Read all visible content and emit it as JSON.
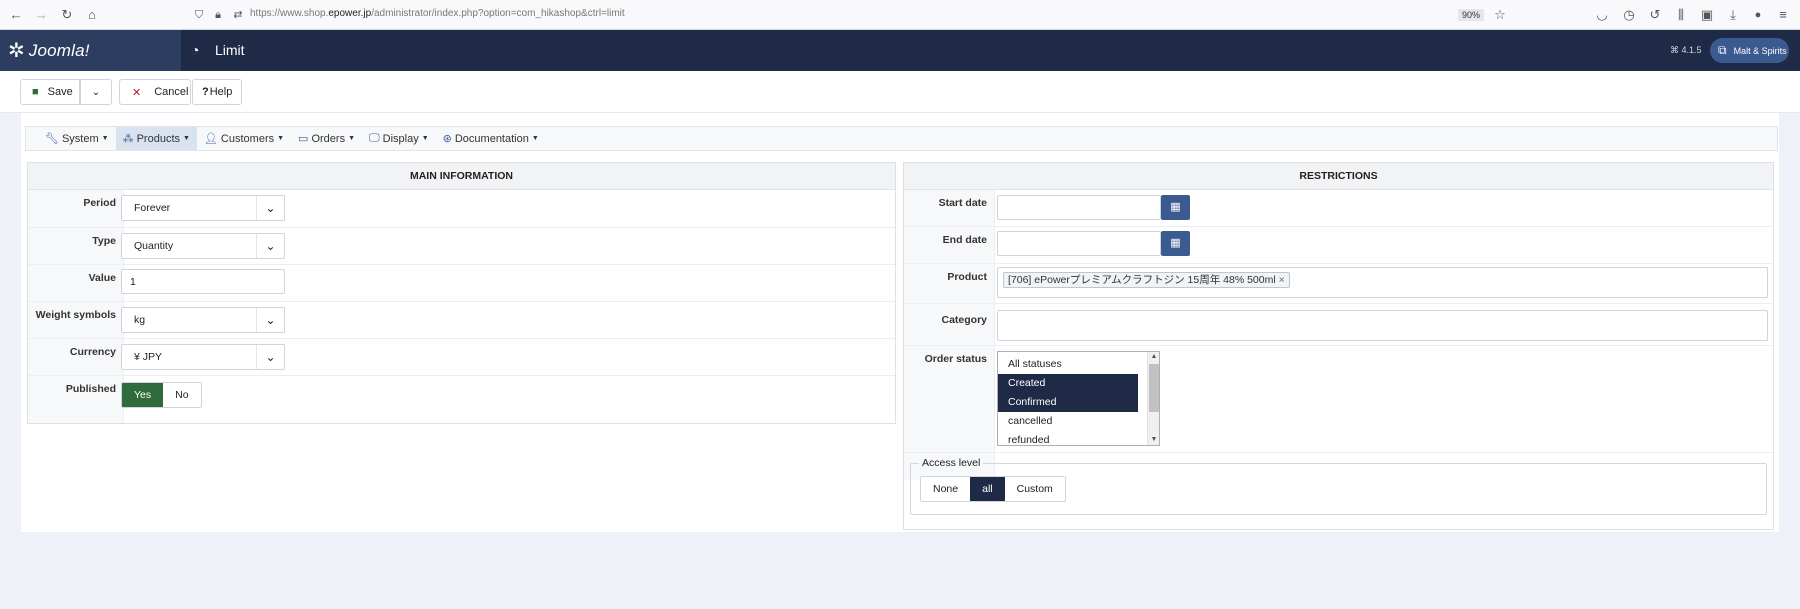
{
  "browser": {
    "url_prefix": "https://www.shop.",
    "url_domain": "epower.jp",
    "url_path": "/administrator/index.php?option=com_hikashop&ctrl=limit",
    "zoom": "90%"
  },
  "header": {
    "logo": "Joomla!",
    "title": "Limit",
    "version": "⌘ 4.1.5",
    "site_button": "Malt & Spirits"
  },
  "toolbar": {
    "save_label": "Save",
    "cancel_label": "Cancel",
    "help_label": "Help"
  },
  "menu": {
    "items": [
      {
        "label": "System",
        "icon": "wrench-icon"
      },
      {
        "label": "Products",
        "icon": "cubes-icon",
        "active": true
      },
      {
        "label": "Customers",
        "icon": "user-icon"
      },
      {
        "label": "Orders",
        "icon": "credit-card-icon"
      },
      {
        "label": "Display",
        "icon": "monitor-icon"
      },
      {
        "label": "Documentation",
        "icon": "lifebuoy-icon"
      }
    ]
  },
  "main_info": {
    "heading": "MAIN INFORMATION",
    "period_label": "Period",
    "period_value": "Forever",
    "type_label": "Type",
    "type_value": "Quantity",
    "value_label": "Value",
    "value_value": "1",
    "weight_label": "Weight symbols",
    "weight_value": "kg",
    "currency_label": "Currency",
    "currency_value": "¥ JPY",
    "published_label": "Published",
    "published_yes": "Yes",
    "published_no": "No",
    "published_selected": "Yes"
  },
  "restrictions": {
    "heading": "RESTRICTIONS",
    "start_date_label": "Start date",
    "start_date_value": "",
    "end_date_label": "End date",
    "end_date_value": "",
    "product_label": "Product",
    "product_tag": "[706] ePowerプレミアムクラフトジン 15周年 48% 500ml",
    "category_label": "Category",
    "order_status_label": "Order status",
    "order_statuses": [
      {
        "label": "All statuses",
        "selected": false
      },
      {
        "label": "Created",
        "selected": true
      },
      {
        "label": "Confirmed",
        "selected": true
      },
      {
        "label": "cancelled",
        "selected": false
      },
      {
        "label": "refunded",
        "selected": false
      }
    ],
    "access_legend": "Access level",
    "access_none": "None",
    "access_all": "all",
    "access_custom": "Custom",
    "access_selected": "all"
  },
  "colors": {
    "topbar": "#1f2b46",
    "accent": "#3b5a8f",
    "published_on": "#2f6b3b",
    "cancel_x": "#c8102e"
  }
}
